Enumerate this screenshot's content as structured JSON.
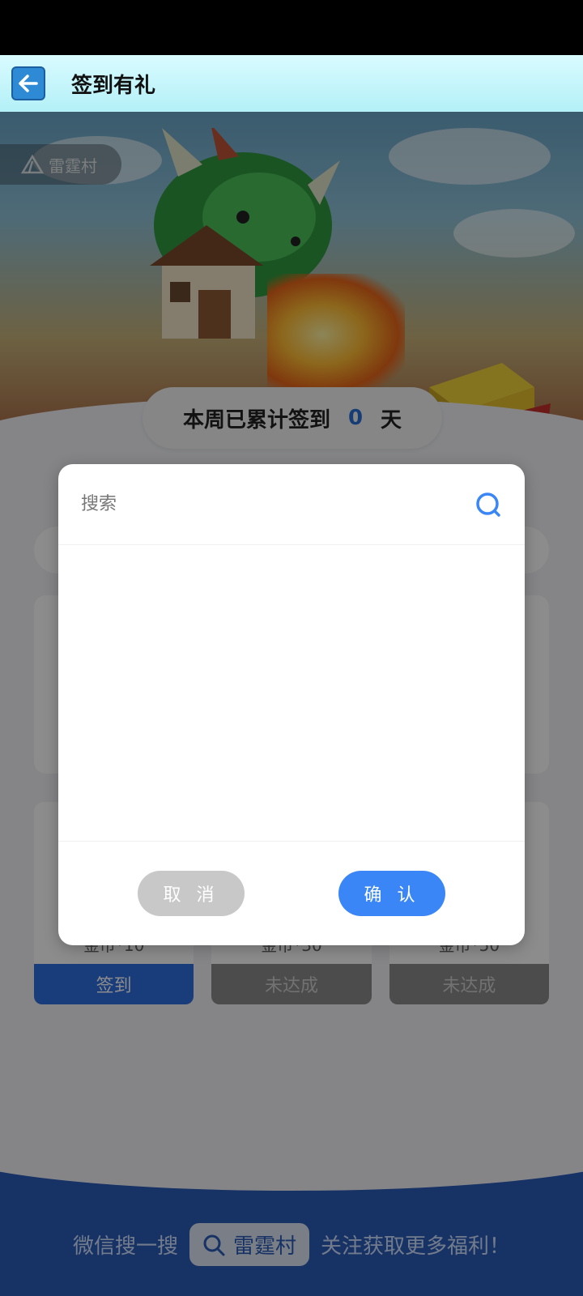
{
  "header": {
    "title": "签到有礼"
  },
  "hero": {
    "brand_tag": "雷霆村"
  },
  "streak": {
    "prefix": "本周已累计签到",
    "count": "0",
    "suffix": "天"
  },
  "days": [
    {
      "reward": "金币*10",
      "button": "签到",
      "state": "available"
    },
    {
      "reward": "金币*30",
      "button": "未达成",
      "state": "locked"
    },
    {
      "reward": "金币*50",
      "button": "未达成",
      "state": "locked"
    }
  ],
  "footer": {
    "left_text": "微信搜一搜",
    "search_text": "雷霆村",
    "right_text": "关注获取更多福利！"
  },
  "dialog": {
    "search_placeholder": "搜索",
    "cancel_label": "取 消",
    "confirm_label": "确 认"
  },
  "colors": {
    "accent": "#3b86f7",
    "footer": "#2a5bb8",
    "streak_count": "#2b6fd8"
  }
}
